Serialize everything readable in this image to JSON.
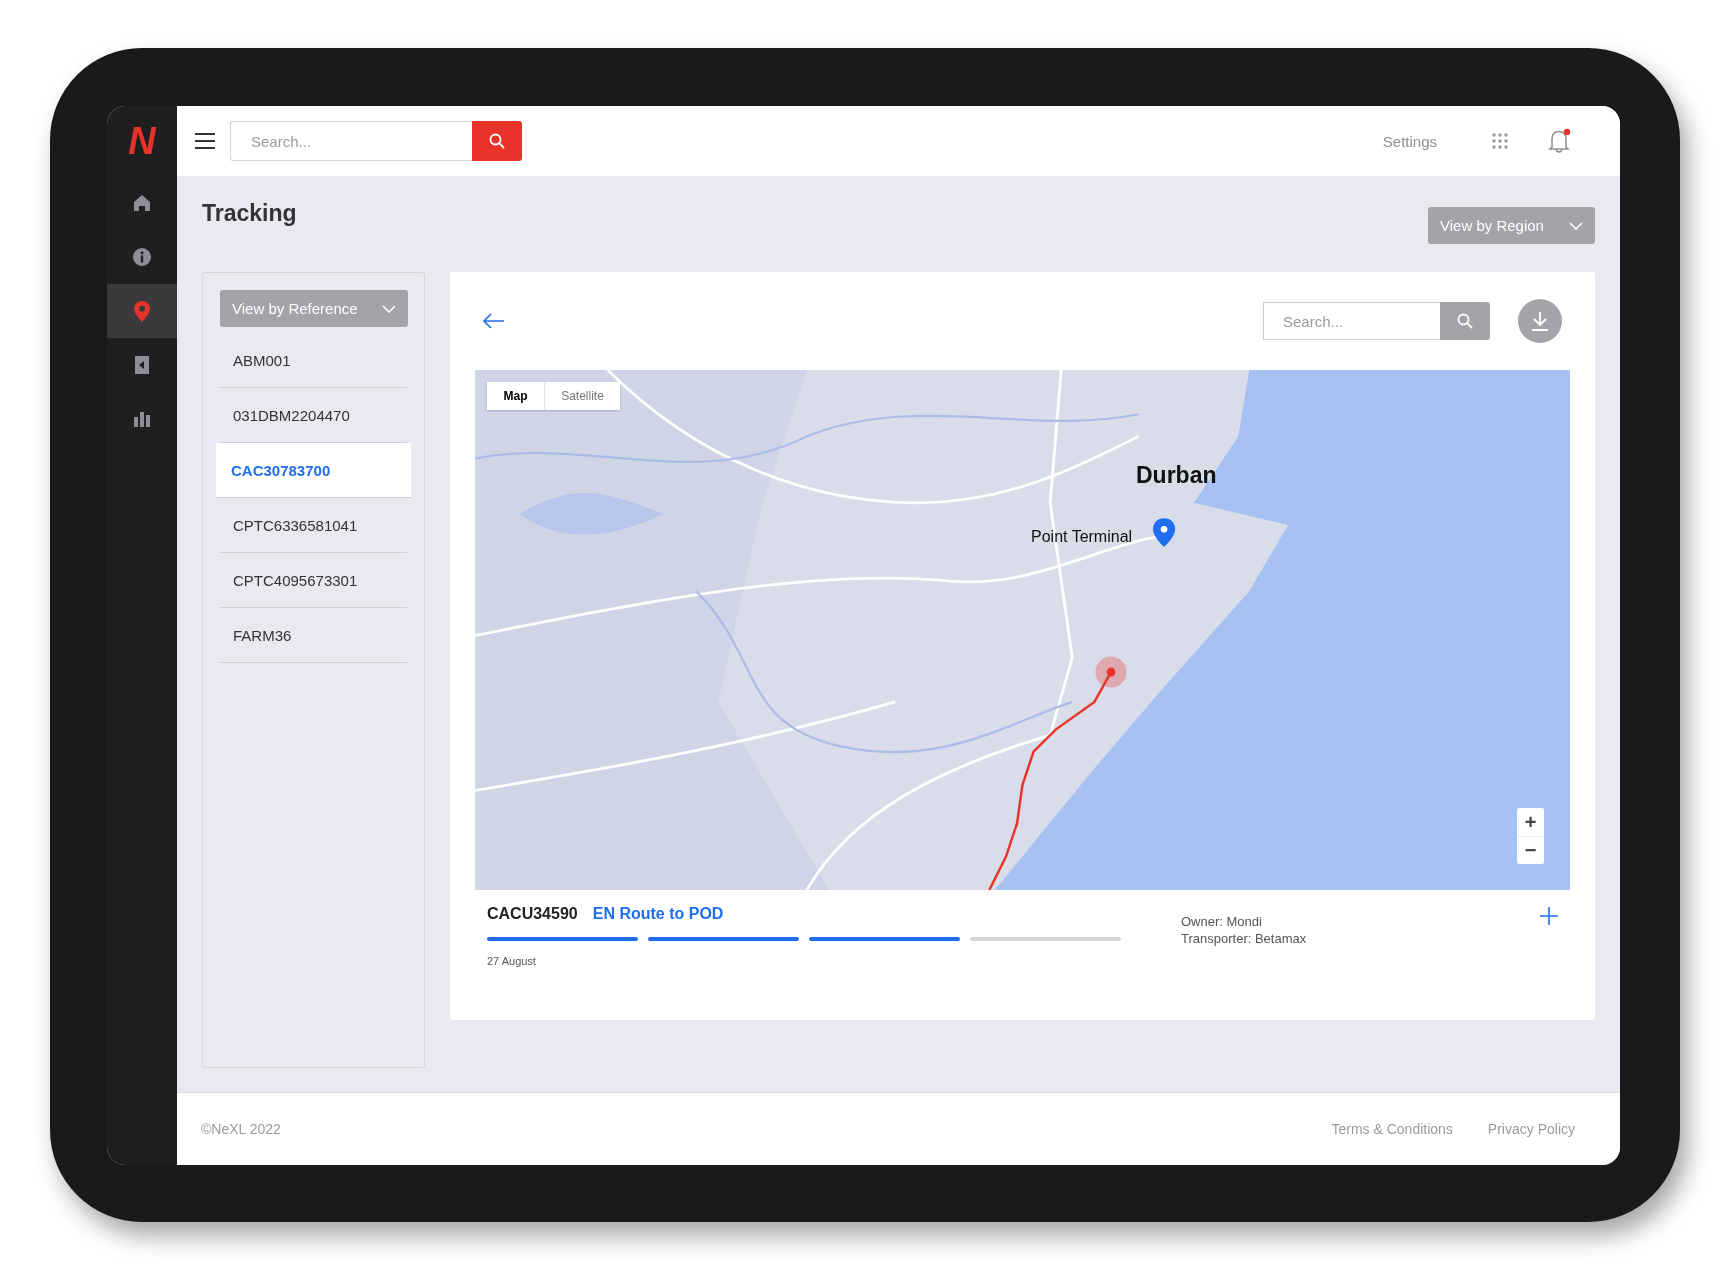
{
  "sidebar": {
    "logo": "N",
    "items": [
      {
        "kind": "home",
        "selected": false
      },
      {
        "kind": "info",
        "selected": false
      },
      {
        "kind": "pin",
        "selected": true
      },
      {
        "kind": "back",
        "selected": false
      },
      {
        "kind": "chart",
        "selected": false
      }
    ]
  },
  "topbar": {
    "search": {
      "placeholder": "Search..."
    },
    "settings": "Settings",
    "has_notification": true
  },
  "page": {
    "title": "Tracking",
    "region_dropdown": "View by Region"
  },
  "references": {
    "dropdown": "View by Reference",
    "items": [
      {
        "label": "ABM001",
        "selected": false
      },
      {
        "label": "031DBM2204470",
        "selected": false
      },
      {
        "label": "CAC30783700",
        "selected": true
      },
      {
        "label": "CPTC6336581041",
        "selected": false
      },
      {
        "label": "CPTC4095673301",
        "selected": false
      },
      {
        "label": "FARM36",
        "selected": false
      }
    ]
  },
  "detail": {
    "search": {
      "placeholder": "Search..."
    },
    "map": {
      "types": [
        {
          "label": "Map",
          "selected": true
        },
        {
          "label": "Satellite",
          "selected": false
        }
      ],
      "labels": [
        {
          "text": "Durban",
          "kind": "city"
        },
        {
          "text": "Point Terminal",
          "kind": "place"
        }
      ],
      "zoom": [
        "+",
        "−"
      ]
    },
    "shipment": {
      "container": "CACU34590",
      "status": "EN Route to POD",
      "steps": [
        {
          "complete": true
        },
        {
          "complete": true
        },
        {
          "complete": true
        },
        {
          "complete": false
        }
      ],
      "date": "27 August",
      "owner": "Owner: Mondi",
      "transporter": "Transporter: Betamax"
    }
  },
  "footer": {
    "copyright": "©NeXL 2022",
    "links": [
      "Terms & Conditions",
      "Privacy Policy"
    ]
  }
}
